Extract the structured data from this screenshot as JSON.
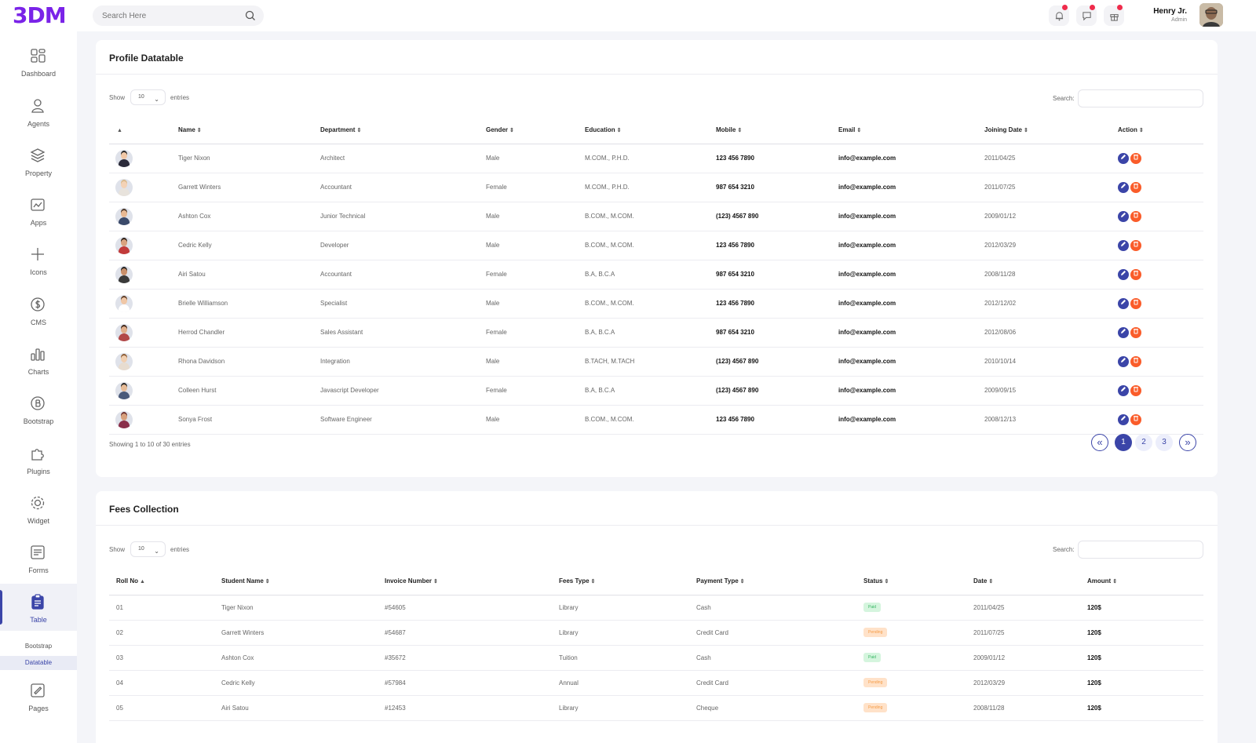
{
  "app": {
    "logo": "3DM"
  },
  "search": {
    "placeholder": "Search Here"
  },
  "user": {
    "name": "Henry Jr.",
    "role": "Admin"
  },
  "sidebar": {
    "items": [
      {
        "label": "Dashboard",
        "icon": "dashboard-icon"
      },
      {
        "label": "Agents",
        "icon": "user-icon"
      },
      {
        "label": "Property",
        "icon": "layers-icon"
      },
      {
        "label": "Apps",
        "icon": "apps-icon"
      },
      {
        "label": "Icons",
        "icon": "plus-icon"
      },
      {
        "label": "CMS",
        "icon": "dollar-icon"
      },
      {
        "label": "Charts",
        "icon": "bar-chart-icon"
      },
      {
        "label": "Bootstrap",
        "icon": "bootstrap-icon"
      },
      {
        "label": "Plugins",
        "icon": "puzzle-icon"
      },
      {
        "label": "Widget",
        "icon": "gear-icon"
      },
      {
        "label": "Forms",
        "icon": "form-icon"
      },
      {
        "label": "Table",
        "icon": "clipboard-icon"
      },
      {
        "label": "Pages",
        "icon": "pages-icon"
      }
    ],
    "table_sub": [
      "Bootstrap",
      "Datatable"
    ]
  },
  "profile": {
    "title": "Profile Datatable",
    "show": "Show",
    "entries_value": "10",
    "entries": "entries",
    "search_label": "Search:",
    "columns": [
      "Name",
      "Department",
      "Gender",
      "Education",
      "Mobile",
      "Email",
      "Joining Date",
      "Action"
    ],
    "rows": [
      [
        "Tiger Nixon",
        "Architect",
        "Male",
        "M.COM., P.H.D.",
        "123 456 7890",
        "info@example.com",
        "2011/04/25"
      ],
      [
        "Garrett Winters",
        "Accountant",
        "Female",
        "M.COM., P.H.D.",
        "987 654 3210",
        "info@example.com",
        "2011/07/25"
      ],
      [
        "Ashton Cox",
        "Junior Technical",
        "Male",
        "B.COM., M.COM.",
        "(123) 4567 890",
        "info@example.com",
        "2009/01/12"
      ],
      [
        "Cedric Kelly",
        "Developer",
        "Male",
        "B.COM., M.COM.",
        "123 456 7890",
        "info@example.com",
        "2012/03/29"
      ],
      [
        "Airi Satou",
        "Accountant",
        "Female",
        "B.A, B.C.A",
        "987 654 3210",
        "info@example.com",
        "2008/11/28"
      ],
      [
        "Brielle Williamson",
        "Specialist",
        "Male",
        "B.COM., M.COM.",
        "123 456 7890",
        "info@example.com",
        "2012/12/02"
      ],
      [
        "Herrod Chandler",
        "Sales Assistant",
        "Female",
        "B.A, B.C.A",
        "987 654 3210",
        "info@example.com",
        "2012/08/06"
      ],
      [
        "Rhona Davidson",
        "Integration",
        "Male",
        "B.TACH, M.TACH",
        "(123) 4567 890",
        "info@example.com",
        "2010/10/14"
      ],
      [
        "Colleen Hurst",
        "Javascript Developer",
        "Female",
        "B.A, B.C.A",
        "(123) 4567 890",
        "info@example.com",
        "2009/09/15"
      ],
      [
        "Sonya Frost",
        "Software Engineer",
        "Male",
        "B.COM., M.COM.",
        "123 456 7890",
        "info@example.com",
        "2008/12/13"
      ]
    ],
    "showing": "Showing 1 to 10 of 30 entries",
    "pages": [
      "1",
      "2",
      "3"
    ],
    "prev": "«",
    "next": "»"
  },
  "fees": {
    "title": "Fees Collection",
    "show": "Show",
    "entries_value": "10",
    "entries": "entries",
    "search_label": "Search:",
    "columns": [
      "Roll No",
      "Student Name",
      "Invoice Number",
      "Fees Type",
      "Payment Type",
      "Status",
      "Date",
      "Amount"
    ],
    "rows": [
      [
        "01",
        "Tiger Nixon",
        "#54605",
        "Library",
        "Cash",
        "Paid",
        "2011/04/25",
        "120$"
      ],
      [
        "02",
        "Garrett Winters",
        "#54687",
        "Library",
        "Credit Card",
        "Pending",
        "2011/07/25",
        "120$"
      ],
      [
        "03",
        "Ashton Cox",
        "#35672",
        "Tuition",
        "Cash",
        "Paid",
        "2009/01/12",
        "120$"
      ],
      [
        "04",
        "Cedric Kelly",
        "#57984",
        "Annual",
        "Credit Card",
        "Pending",
        "2012/03/29",
        "120$"
      ],
      [
        "05",
        "Airi Satou",
        "#12453",
        "Library",
        "Cheque",
        "Pending",
        "2008/11/28",
        "120$"
      ]
    ]
  },
  "colors": {
    "accent": "#3b45a8",
    "brand": "#7a23e8",
    "danger": "#fa5c2a",
    "notify": "#ef2b4b"
  }
}
